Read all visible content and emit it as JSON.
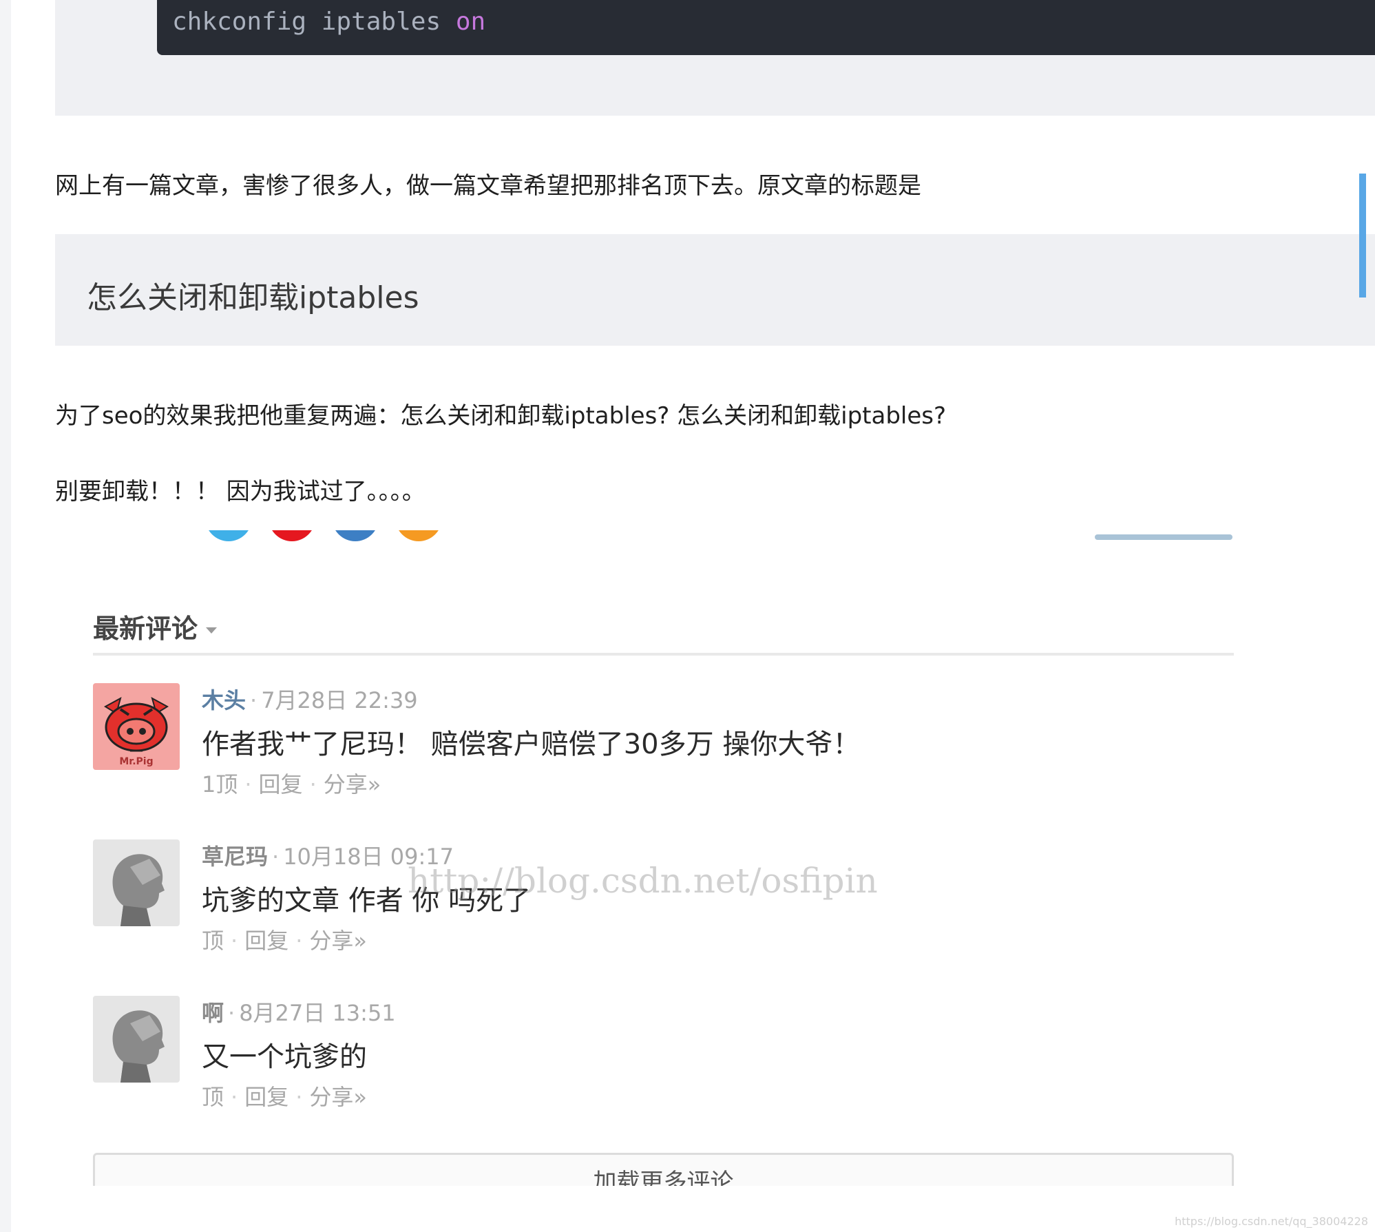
{
  "code": {
    "command": "chkconfig iptables",
    "keyword": "on"
  },
  "article": {
    "para1": "网上有一篇文章，害惨了很多人，做一篇文章希望把那排名顶下去。原文章的标题是",
    "quote_title": "怎么关闭和卸载iptables",
    "para2": "为了seo的效果我把他重复两遍：怎么关闭和卸载iptables? 怎么关闭和卸载iptables?",
    "para3": "别要卸载！！！ 因为我试过了。。。。"
  },
  "share_colors": [
    "#3fb0e8",
    "#e5171f",
    "#3d7fc4",
    "#f59a22"
  ],
  "comments": {
    "header": "最新评论",
    "items": [
      {
        "author": "木头",
        "time": "7月28日 22:39",
        "text": "作者我艹了尼玛！ 赔偿客户赔偿了30多万 操你大爷！",
        "up": "1顶",
        "reply": "回复",
        "share": "分享»",
        "avatar": "pig-avatar"
      },
      {
        "author": "草尼玛",
        "time": "10月18日 09:17",
        "text": "坑爹的文章 作者 你 吗死了",
        "up": "顶",
        "reply": "回复",
        "share": "分享»",
        "avatar": "person-avatar"
      },
      {
        "author": "啊",
        "time": "8月27日 13:51",
        "text": "又一个坑爹的",
        "up": "顶",
        "reply": "回复",
        "share": "分享»",
        "avatar": "person-avatar"
      }
    ],
    "load_more": "加载更多评论"
  },
  "watermark": "http://blog.csdn.net/osfipin",
  "footer_watermark": "https://blog.csdn.net/qq_38004228"
}
